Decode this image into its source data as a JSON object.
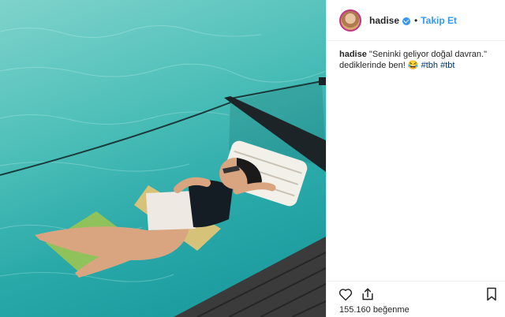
{
  "post": {
    "username": "hadise",
    "verified_icon": "verified-badge-icon",
    "follow_label": "Takip Et",
    "caption_user": "hadise",
    "caption_text": " \"Seninki geliyor doğal davran.\" dediklerinde ben! 😂 ",
    "hashtags": [
      "#tbh",
      "#tbt"
    ],
    "likes_text": "155.160 beğenme"
  },
  "actions": {
    "like_icon": "heart-icon",
    "share_icon": "share-icon",
    "save_icon": "bookmark-icon"
  },
  "colors": {
    "accent": "#3897f0",
    "hashtag": "#003569",
    "water": "#2aa9a9"
  }
}
